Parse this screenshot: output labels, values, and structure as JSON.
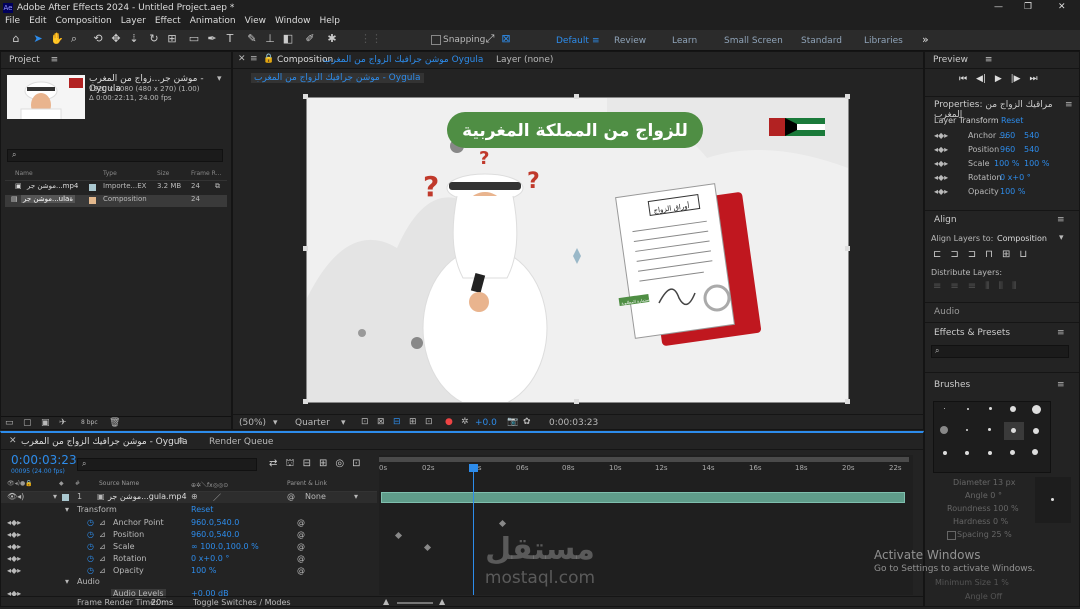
{
  "app": {
    "title": "Adobe After Effects 2024 - Untitled Project.aep *",
    "menu": [
      "File",
      "Edit",
      "Composition",
      "Layer",
      "Effect",
      "Animation",
      "View",
      "Window",
      "Help"
    ],
    "window_controls": [
      "—",
      "❐",
      "✕"
    ]
  },
  "toolbar": {
    "snapping_label": "Snapping",
    "workspaces": [
      "Default",
      "Review",
      "Learn",
      "Small Screen",
      "Standard",
      "Libraries"
    ],
    "active_workspace": "Default"
  },
  "project": {
    "panel_title": "Project",
    "item_name": "موشن جر...زواج من المغرب - Oygula",
    "item_details": "1920 x 1080 (480 x 270) (1.00)",
    "item_duration": "Δ 0:00:22:11, 24.00 fps",
    "columns": [
      "Name",
      "Type",
      "Size",
      "Frame R..."
    ],
    "rows": [
      {
        "name": "موشن جر...mp4",
        "type": "Importe...EX",
        "size": "3.2 MB",
        "fps": "24"
      },
      {
        "name": "موشن جر...ulaة",
        "type": "Composition",
        "size": "",
        "fps": "24"
      }
    ],
    "bpc": "8 bpc"
  },
  "composition": {
    "tab_label": "Composition",
    "tab_name": "موشن جرافيك الزواج من المغرب Oygula",
    "layer_tab": "Layer (none)",
    "breadcrumb": "موشن جرافيك الزواج من المغرب - Oygula",
    "zoom": "(50%)",
    "resolution": "Quarter",
    "exposure": "+0.0",
    "timecode": "0:00:03:23",
    "video": {
      "banner": "للزواج من المملكة    المغربية",
      "paper_title": "أوراق الزواج",
      "stamp_label": "الاستمارة المطلوبة"
    }
  },
  "right": {
    "preview_title": "Preview",
    "properties_title": "Properties: مراقيك الزواج من المغرب",
    "layer_transform": "Layer Transform",
    "reset": "Reset",
    "props": [
      {
        "name": "Anchor ...",
        "v1": "960",
        "v2": "540"
      },
      {
        "name": "Position",
        "v1": "960",
        "v2": "540"
      },
      {
        "name": "Scale",
        "v1": "100 %",
        "v2": "100 %"
      },
      {
        "name": "Rotation",
        "v1": "0 x+0 °",
        "v2": ""
      },
      {
        "name": "Opacity",
        "v1": "100 %",
        "v2": ""
      }
    ],
    "align_title": "Align",
    "align_layers_to": "Align Layers to:",
    "align_target": "Composition",
    "distribute_layers": "Distribute Layers:",
    "audio_title": "Audio",
    "effects_title": "Effects & Presets",
    "brushes_title": "Brushes",
    "brush_sizes": [
      "1",
      "3",
      "5",
      "9",
      "13",
      "19",
      "5",
      "9",
      "13",
      "17",
      "21",
      "27",
      "35",
      "45",
      "65"
    ],
    "diameter": "Diameter  13 px",
    "angle": "Angle  0 °",
    "roundness": "Roundness  100 %",
    "hardness": "Hardness  0 %",
    "spacing": "Spacing  25 %",
    "min_size": "Minimum Size  1 %",
    "angle2": "Angle  Off"
  },
  "timeline": {
    "tab_comp": "موشن جرافيك الزواج من المغرب - Oygula",
    "tab_render": "Render Queue",
    "timecode": "0:00:03:23",
    "frames": "00095 (24.00 fps)",
    "col_source": "Source Name",
    "col_parent": "Parent & Link",
    "layer_number": "1",
    "layer_name": "موشن جر...gula.mp4",
    "parent_value": "None",
    "transform_label": "Transform",
    "reset": "Reset",
    "props": [
      {
        "name": "Anchor Point",
        "value": "960.0,540.0"
      },
      {
        "name": "Position",
        "value": "960.0,540.0"
      },
      {
        "name": "Scale",
        "value": "∞ 100.0,100.0 %"
      },
      {
        "name": "Rotation",
        "value": "0 x+0.0 °"
      },
      {
        "name": "Opacity",
        "value": "100 %"
      }
    ],
    "audio_label": "Audio",
    "audio_levels": "Audio Levels",
    "audio_value": "+0.00 dB",
    "ruler": [
      "0s",
      "02s",
      "04s",
      "06s",
      "08s",
      "10s",
      "12s",
      "14s",
      "16s",
      "18s",
      "20s",
      "22s"
    ],
    "render_time_label": "Frame Render Time:",
    "render_time": "20ms",
    "toggle": "Toggle Switches / Modes"
  },
  "overlay": {
    "activate_title": "Activate Windows",
    "activate_sub": "Go to Settings to activate Windows.",
    "watermark_ar": "مستقل",
    "watermark_en": "mostaql.com"
  },
  "colors": {
    "accent": "#2d8ceb",
    "banner": "#4f8e44",
    "keyframe_bar": "#5f9c8a"
  }
}
